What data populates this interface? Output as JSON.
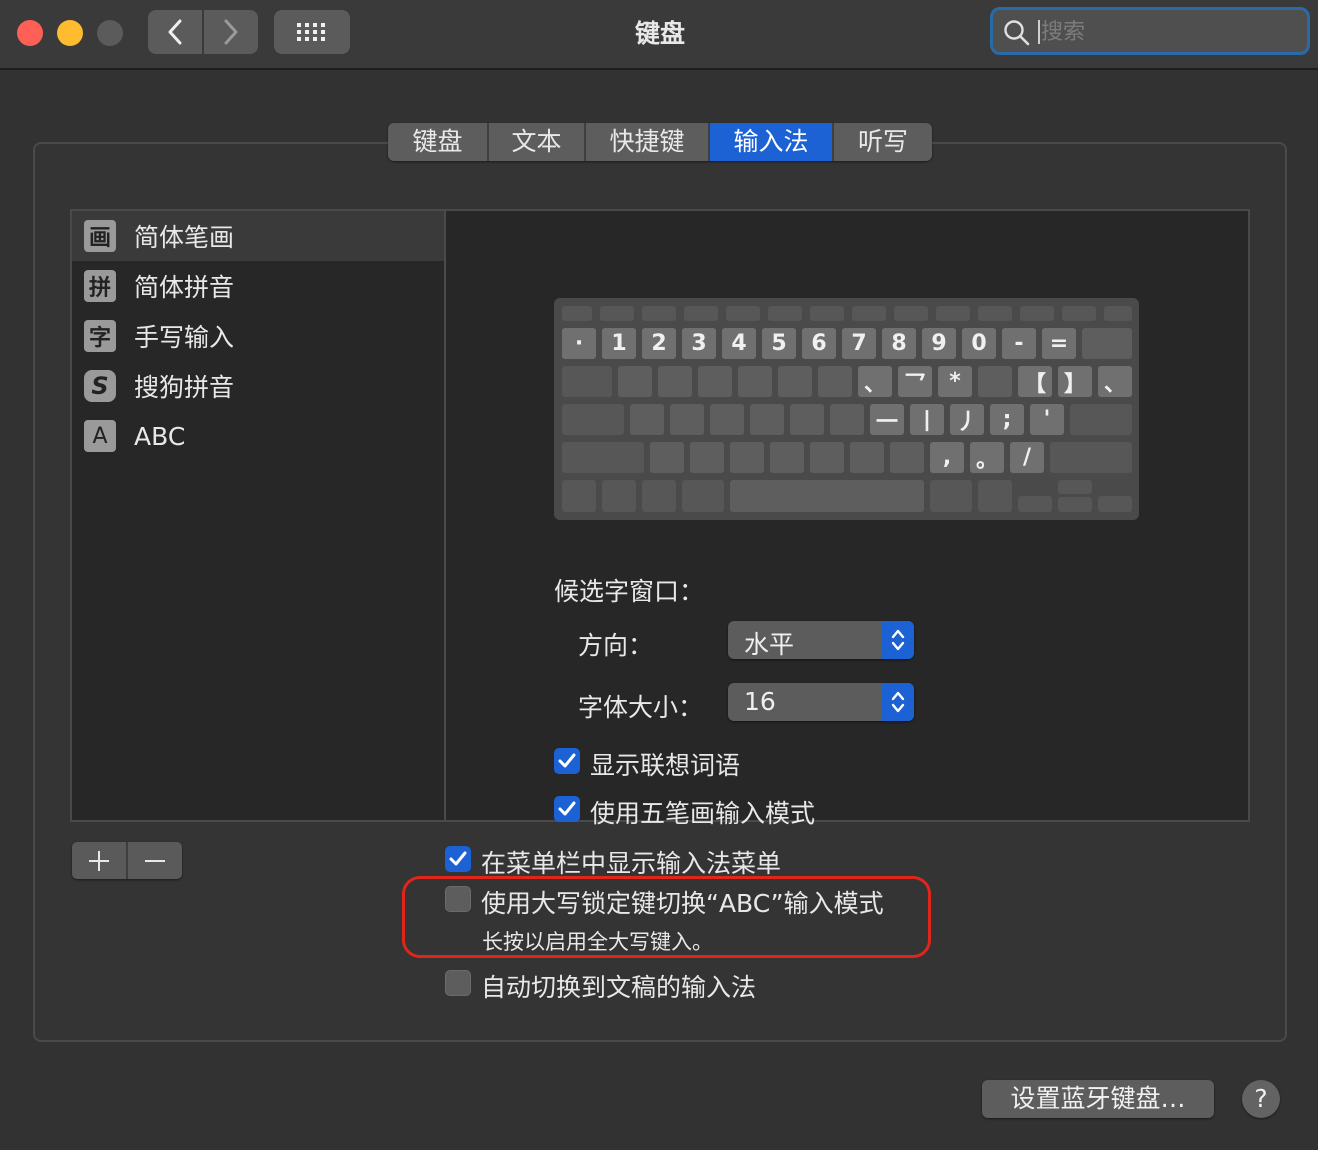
{
  "window": {
    "title": "键盘"
  },
  "search": {
    "placeholder": "搜索",
    "value": ""
  },
  "tabs": [
    {
      "label": "键盘",
      "active": false
    },
    {
      "label": "文本",
      "active": false
    },
    {
      "label": "快捷键",
      "active": false
    },
    {
      "label": "输入法",
      "active": true
    },
    {
      "label": "听写",
      "active": false
    }
  ],
  "input_sources": [
    {
      "icon": "画",
      "label": "简体笔画",
      "selected": true
    },
    {
      "icon": "拼",
      "label": "简体拼音",
      "selected": false
    },
    {
      "icon": "字",
      "label": "手写输入",
      "selected": false
    },
    {
      "icon": "S",
      "label": "搜狗拼音",
      "selected": false
    },
    {
      "icon": "A",
      "label": "ABC",
      "selected": false
    }
  ],
  "keyboard_keys": {
    "row1": [
      "·",
      "1",
      "2",
      "3",
      "4",
      "5",
      "6",
      "7",
      "8",
      "9",
      "0",
      "-",
      "="
    ],
    "row2": [
      "、",
      "乛",
      "*",
      "【",
      "】",
      "、"
    ],
    "row3": [
      "一",
      "丨",
      "丿",
      ";",
      "'"
    ],
    "row4": [
      ",",
      "。",
      "/"
    ]
  },
  "candidate": {
    "section_label": "候选字窗口：",
    "direction_label": "方向：",
    "direction_value": "水平",
    "fontsize_label": "字体大小：",
    "fontsize_value": "16"
  },
  "options": {
    "show_suggestions": {
      "label": "显示联想词语",
      "checked": true
    },
    "wubi_mode": {
      "label": "使用五笔画输入模式",
      "checked": true
    },
    "show_menu": {
      "label": "在菜单栏中显示输入法菜单",
      "checked": true
    },
    "capslock_abc": {
      "label": "使用大写锁定键切换“ABC”输入模式",
      "checked": false,
      "hint": "长按以启用全大写键入。"
    },
    "auto_switch": {
      "label": "自动切换到文稿的输入法",
      "checked": false
    }
  },
  "buttons": {
    "add": "+",
    "remove": "−",
    "bluetooth": "设置蓝牙键盘…",
    "help": "?"
  },
  "colors": {
    "accent": "#1c62d4",
    "highlight_border": "#e0261b"
  }
}
